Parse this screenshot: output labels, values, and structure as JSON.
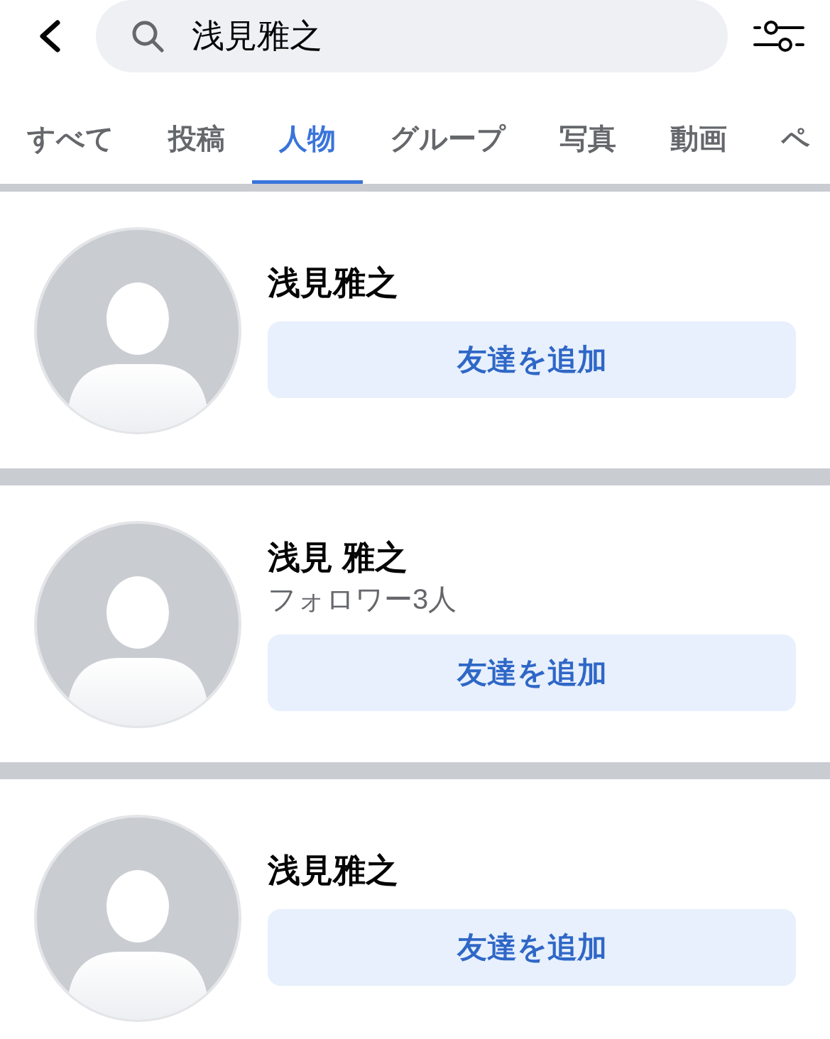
{
  "header": {
    "search": {
      "value": "浅見雅之"
    }
  },
  "tabs": [
    {
      "label": "すべて",
      "selected": false
    },
    {
      "label": "投稿",
      "selected": false
    },
    {
      "label": "人物",
      "selected": true
    },
    {
      "label": "グループ",
      "selected": false
    },
    {
      "label": "写真",
      "selected": false
    },
    {
      "label": "動画",
      "selected": false
    },
    {
      "label": "ペ",
      "selected": false
    }
  ],
  "results": [
    {
      "name": "浅見雅之",
      "button": "友達を追加"
    },
    {
      "name": "浅見 雅之",
      "followers": "フォロワー3人",
      "button": "友達を追加"
    },
    {
      "name": "浅見雅之",
      "button": "友達を追加"
    }
  ]
}
